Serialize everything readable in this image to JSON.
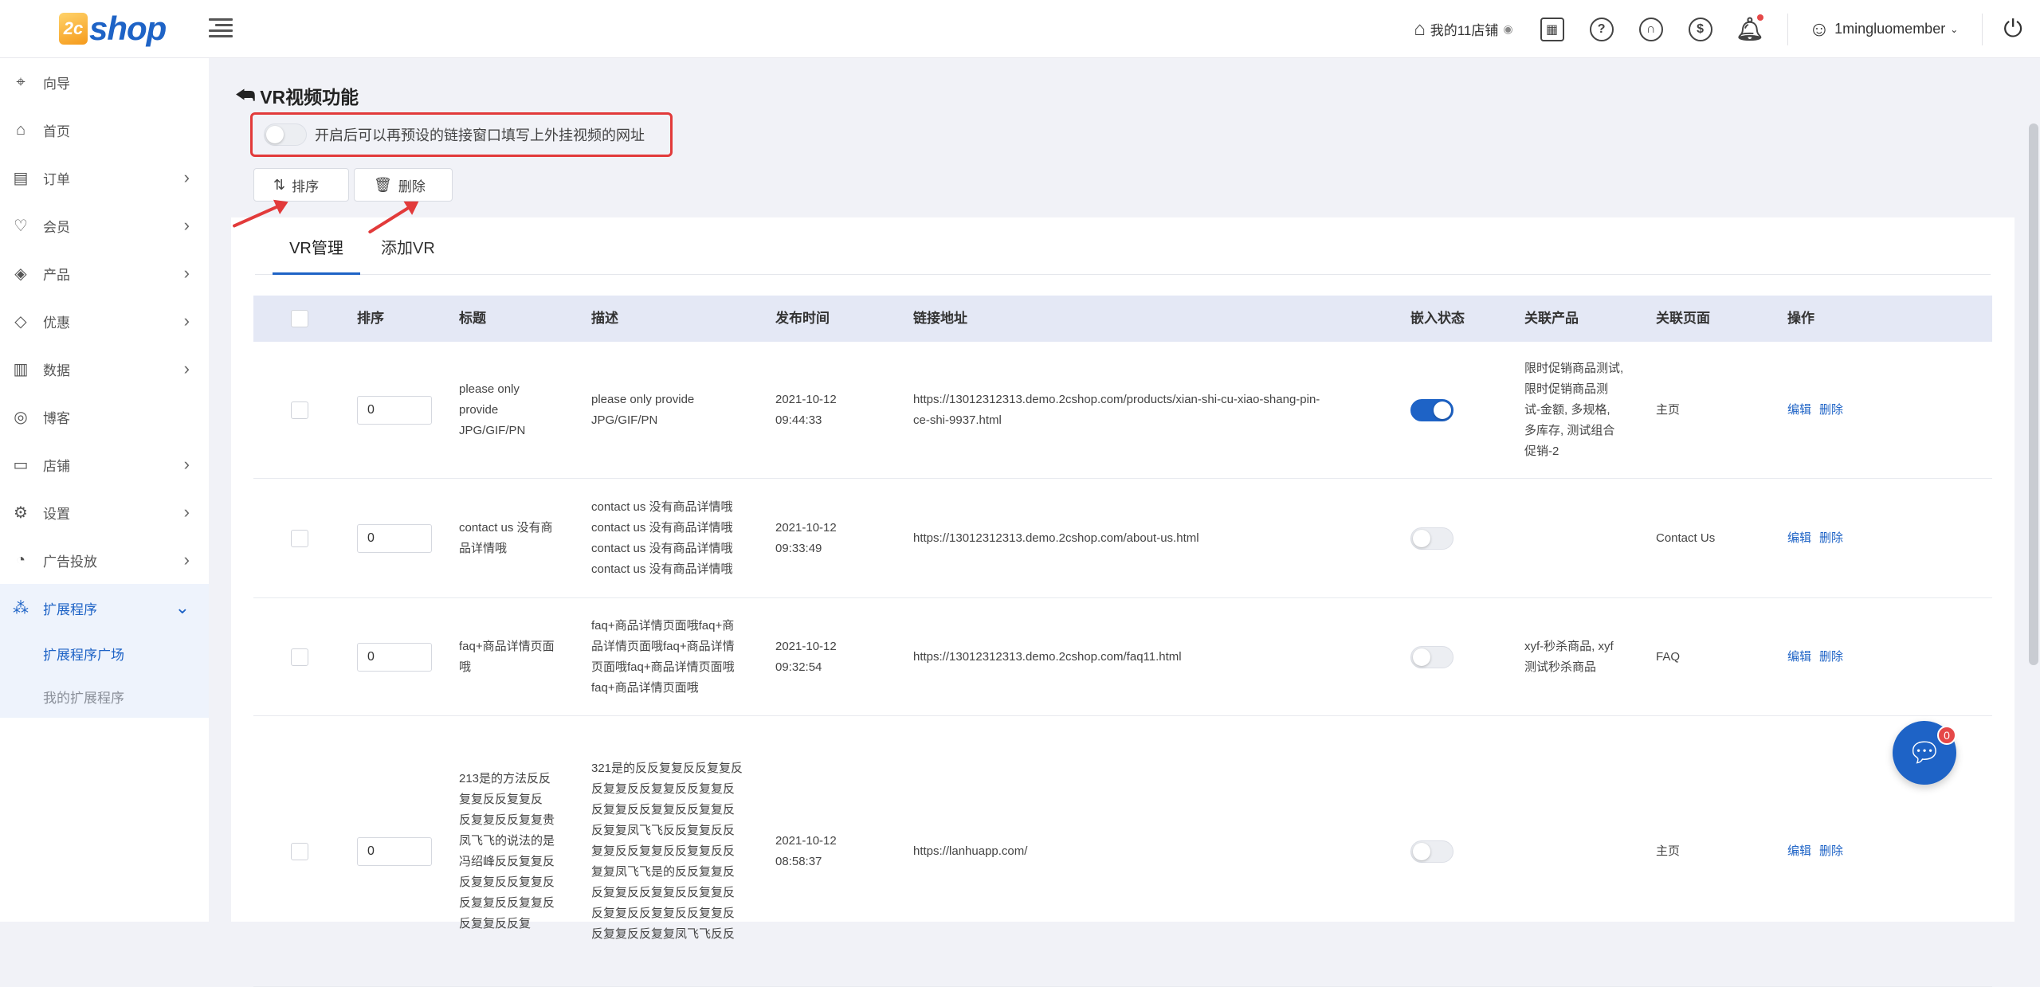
{
  "brand": {
    "badge": "2c",
    "name": "shop"
  },
  "topbar": {
    "store_label": "我的11店铺",
    "user_name": "1mingluomember",
    "icons": [
      "store-icon",
      "eye-icon",
      "qrcode-icon",
      "help-icon",
      "headset-icon",
      "settings-icon",
      "bell-icon",
      "user-icon",
      "power-icon"
    ]
  },
  "sidebar": {
    "items": [
      {
        "label": "向导",
        "icon": "guide-icon",
        "glyph": "⌖",
        "has_arrow": false
      },
      {
        "label": "首页",
        "icon": "home-icon",
        "glyph": "⌂",
        "has_arrow": false
      },
      {
        "label": "订单",
        "icon": "order-icon",
        "glyph": "▤",
        "has_arrow": true
      },
      {
        "label": "会员",
        "icon": "member-icon",
        "glyph": "♡",
        "has_arrow": true
      },
      {
        "label": "产品",
        "icon": "product-icon",
        "glyph": "◈",
        "has_arrow": true
      },
      {
        "label": "优惠",
        "icon": "coupon-icon",
        "glyph": "◇",
        "has_arrow": true
      },
      {
        "label": "数据",
        "icon": "chart-icon",
        "glyph": "▥",
        "has_arrow": true
      },
      {
        "label": "博客",
        "icon": "blog-icon",
        "glyph": "◎",
        "has_arrow": false
      },
      {
        "label": "店铺",
        "icon": "shop-icon",
        "glyph": "▭",
        "has_arrow": true
      },
      {
        "label": "设置",
        "icon": "gear-icon",
        "glyph": "⚙",
        "has_arrow": true
      },
      {
        "label": "广告投放",
        "icon": "ads-icon",
        "glyph": "◔",
        "has_arrow": true
      },
      {
        "label": "扩展程序",
        "icon": "extension-icon",
        "glyph": "⁂",
        "has_arrow": true,
        "active": true
      }
    ],
    "sub_items": [
      {
        "label": "扩展程序广场",
        "active": true
      },
      {
        "label": "我的扩展程序",
        "active": false
      }
    ]
  },
  "page": {
    "title": "VR视频功能",
    "hint": "开启后可以再预设的链接窗口填写上外挂视频的网址",
    "sort_button": "排序",
    "delete_button": "删除"
  },
  "tabs": [
    {
      "label": "VR管理",
      "active": true
    },
    {
      "label": "添加VR",
      "active": false
    }
  ],
  "table": {
    "headers": [
      "排序",
      "标题",
      "描述",
      "发布时间",
      "链接地址",
      "嵌入状态",
      "关联产品",
      "关联页面",
      "操作"
    ],
    "edit_label": "编辑",
    "delete_label": "删除",
    "rows": [
      {
        "sort": "0",
        "title": [
          "please only",
          "provide",
          "JPG/GIF/PN"
        ],
        "desc": [
          "please only provide",
          "JPG/GIF/PN"
        ],
        "date": "2021-10-12",
        "time": "09:44:33",
        "link": [
          "https://13012312313.demo.2cshop.com/products/xian-shi-cu-xiao-shang-pin-",
          "ce-shi-9937.html"
        ],
        "embed": true,
        "products": [
          "限时促销商品测试,",
          "限时促销商品测",
          "试-金额, 多规格,",
          "多库存, 测试组合",
          "促销-2"
        ],
        "page": "主页"
      },
      {
        "sort": "0",
        "title": [
          "contact us 没有商",
          "品详情哦"
        ],
        "desc": [
          "contact us 没有商品详情哦",
          "contact us 没有商品详情哦",
          "contact us 没有商品详情哦",
          "contact us 没有商品详情哦"
        ],
        "date": "2021-10-12",
        "time": "09:33:49",
        "link": [
          "https://13012312313.demo.2cshop.com/about-us.html"
        ],
        "embed": false,
        "products": [],
        "page": "Contact Us"
      },
      {
        "sort": "0",
        "title": [
          "faq+商品详情页面",
          "哦"
        ],
        "desc": [
          "faq+商品详情页面哦faq+商",
          "品详情页面哦faq+商品详情",
          "页面哦faq+商品详情页面哦",
          "faq+商品详情页面哦"
        ],
        "date": "2021-10-12",
        "time": "09:32:54",
        "link": [
          "https://13012312313.demo.2cshop.com/faq11.html"
        ],
        "embed": false,
        "products": [
          "xyf-秒杀商品, xyf",
          "测试秒杀商品"
        ],
        "page": "FAQ"
      },
      {
        "sort": "0",
        "title": [
          "213是的方法反反",
          "复复反反复复反",
          "反复复反反复复贵",
          "凤飞飞的说法的是",
          "冯绍峰反反复复反",
          "反复复反反复复反",
          "反复复反反复复反",
          "反复复反反复"
        ],
        "desc": [
          "321是的反反复复反反复复反",
          "反复复反反复复反反复复反",
          "反复复反反复复反反复复反",
          "反复复凤飞飞反反复复反反",
          "复复反反复复反反复复反反",
          "复复凤飞飞是的反反复复反",
          "反复复反反复复反反复复反",
          "反复复反反复复反反复复反",
          "反复复反反复复凤飞飞反反"
        ],
        "date": "2021-10-12",
        "time": "08:58:37",
        "link": [
          "https://lanhuapp.com/"
        ],
        "embed": false,
        "products": [],
        "page": "主页"
      }
    ]
  },
  "chat": {
    "badge": "0"
  },
  "colors": {
    "accent": "#1e63c6",
    "annotation": "#e23a3a",
    "header_bg": "#e4e8f5"
  }
}
